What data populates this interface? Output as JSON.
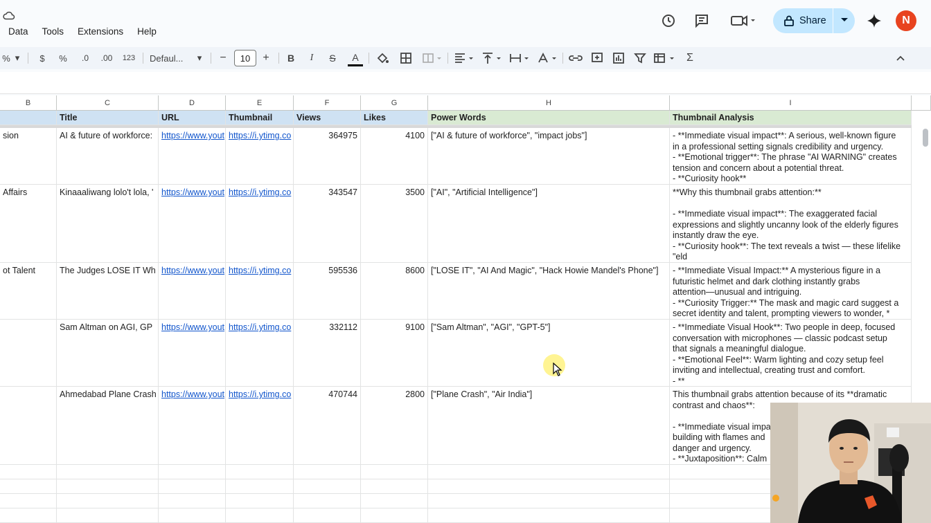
{
  "menu": [
    "Data",
    "Tools",
    "Extensions",
    "Help"
  ],
  "share": {
    "label": "Share"
  },
  "avatar": {
    "letter": "N",
    "color": "#e8431f"
  },
  "toolbar": {
    "percent": "%",
    "currency": "$",
    "percent2": "%",
    "dec_minus": ".0",
    "dec_plus": ".00",
    "format_123": "123",
    "font": "Defaul...",
    "font_size": "10",
    "minus": "−",
    "plus": "+",
    "bold": "B",
    "italic": "I",
    "strike": "S",
    "text_color": "A",
    "sigma": "Σ"
  },
  "columns": [
    "B",
    "C",
    "D",
    "E",
    "F",
    "G",
    "H",
    "I"
  ],
  "headers": [
    "",
    "Title",
    "URL",
    "Thumbnail",
    "Views",
    "Likes",
    "Power Words",
    "Thumbnail Analysis"
  ],
  "rows": [
    {
      "b": "sion",
      "title": "AI & future of workforce: ",
      "url": "https://www.yout",
      "thumb": "https://i.ytimg.co",
      "views": "364975",
      "likes": "4100",
      "power": "[\"AI & future of workforce\", \"impact jobs\"]",
      "analysis": "- **Immediate visual impact**: A serious, well-known figure\nin a professional setting signals credibility and urgency.\n- **Emotional trigger**: The phrase \"AI WARNING\" creates\ntension and concern about a potential threat.\n- **Curiosity hook**"
    },
    {
      "b": "Affairs",
      "title": "Kinaaaliwang lolo't lola, '",
      "url": "https://www.yout",
      "thumb": "https://i.ytimg.co",
      "views": "343547",
      "likes": "3500",
      "power": "[\"AI\", \"Artificial Intelligence\"]",
      "analysis": "**Why this thumbnail grabs attention:**\n\n- **Immediate visual impact**: The exaggerated facial\nexpressions and slightly uncanny look of the elderly figures\ninstantly draw the eye.\n- **Curiosity hook**: The text reveals a twist — these lifelike\n\"eld"
    },
    {
      "b": "ot Talent",
      "title": "The Judges LOSE IT Wh",
      "url": "https://www.yout",
      "thumb": "https://i.ytimg.co",
      "views": "595536",
      "likes": "8600",
      "power": "[\"LOSE IT\", \"AI And Magic\", \"Hack Howie Mandel's Phone\"]",
      "analysis": "- **Immediate Visual Impact:** A mysterious figure in a\nfuturistic helmet and dark clothing instantly grabs\nattention—unusual and intriguing.\n- **Curiosity Trigger:** The mask and magic card suggest a\nsecret identity and talent, prompting viewers to wonder, *"
    },
    {
      "b": "",
      "title": "Sam Altman on AGI, GP",
      "url": "https://www.yout",
      "thumb": "https://i.ytimg.co",
      "views": "332112",
      "likes": "9100",
      "power": "[\"Sam Altman\", \"AGI\", \"GPT-5\"]",
      "analysis": "- **Immediate Visual Hook**: Two people in deep, focused\nconversation with microphones — classic podcast setup\nthat signals a meaningful dialogue.\n- **Emotional Feel**: Warm lighting and cozy setup feel\ninviting and intellectual, creating trust and comfort.\n- **"
    },
    {
      "b": "",
      "title": "Ahmedabad Plane Crash",
      "url": "https://www.yout",
      "thumb": "https://i.ytimg.co",
      "views": "470744",
      "likes": "2800",
      "power": "[\"Plane Crash\", \"Air India\"]",
      "analysis": "This thumbnail grabs attention because of its **dramatic\ncontrast and chaos**:\n\n- **Immediate visual impa\nbuilding with flames and \ndanger and urgency.\n- **Juxtaposition**: Calm "
    }
  ]
}
